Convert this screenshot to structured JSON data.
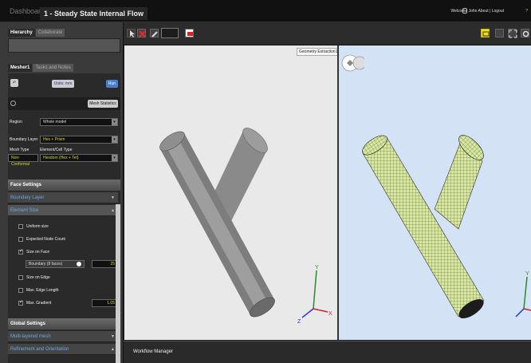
{
  "topbar": {
    "dashboard": "Dashboard",
    "project": "1 - Steady State Internal Flow",
    "welcome": "Welcome John   About | Logout"
  },
  "left": {
    "hierarchy_tab": "Hierarchy",
    "collaborate_tab": "Collaborate",
    "mesher_tab": "Mesher1",
    "tasks_tab": "Tasks and Notes",
    "units_label": "Units: mm",
    "run_label": "Run",
    "mesh_stats": "Mesh Statistics",
    "region_label": "Region",
    "region_value": "Whole model",
    "boundary_label": "Boundary Layer",
    "boundary_value": "Hex + Prism",
    "mesh_type_label": "Mesh Type",
    "element_type_label": "Element/Cell Type",
    "mesh_type_value": "Non-Conformal",
    "element_type_value": "Hexdom (Hex + Tet)",
    "face_settings": "Face Settings",
    "boundary_layer_sub": "Boundary Layer",
    "element_size_sub": "Element Size",
    "uniform_size": "Uniform size",
    "expected_node": "Expected Node Count",
    "size_on_face": "Size on Face",
    "boundary_faces": "Boundary   (8 faces)",
    "face_value": "25",
    "size_on_edge": "Size on Edge",
    "max_edge": "Max. Edge Length",
    "max_gradient": "Max. Gradient",
    "gradient_value": "1.05",
    "global_settings": "Global Settings",
    "multi_layer": "Multi-layered mesh",
    "refinement": "Refinement and Orientation"
  },
  "viewport": {
    "geo_label": "Geometry Extraction1"
  },
  "workflow": {
    "label": "Workflow Manager"
  }
}
